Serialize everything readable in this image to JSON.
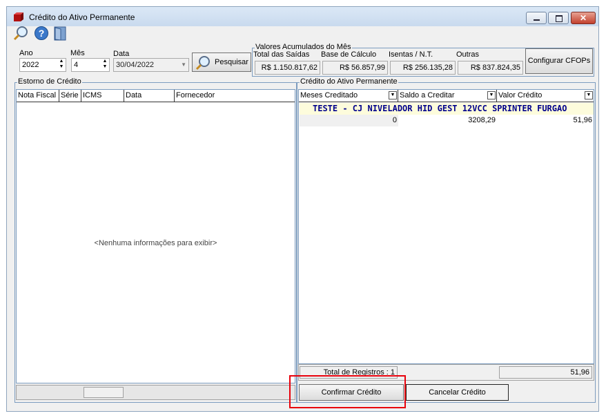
{
  "window": {
    "title": "Crédito do Ativo Permanente"
  },
  "filters": {
    "ano_label": "Ano",
    "ano_value": "2022",
    "mes_label": "Mês",
    "mes_value": "4",
    "data_label": "Data",
    "data_value": "30/04/2022",
    "search_label": "Pesquisar"
  },
  "valores": {
    "group_title": "Valores Acumulados do Mês",
    "total_saidas_label": "Total das Saídas",
    "total_saidas_value": "R$ 1.150.817,62",
    "base_calculo_label": "Base de Cálculo",
    "base_calculo_value": "R$ 56.857,99",
    "isentas_label": "Isentas / N.T.",
    "isentas_value": "R$ 256.135,28",
    "outras_label": "Outras",
    "outras_value": "R$ 837.824,35",
    "configurar_label": "Configurar CFOPs"
  },
  "estorno": {
    "group_title": "Estorno de Crédito",
    "columns": [
      "Nota Fiscal",
      "Série",
      "ICMS",
      "Data",
      "Fornecedor"
    ],
    "empty_text": "<Nenhuma informações para exibir>"
  },
  "credito": {
    "group_title": "Crédito do Ativo Permanente",
    "columns": [
      "Meses Creditado",
      "Saldo a Creditar",
      "Valor Crédito"
    ],
    "group_row": "TESTE - CJ NIVELADOR HID GEST 12VCC SPRINTER FURGAO",
    "rows": [
      {
        "meses": "0",
        "saldo": "3208,29",
        "valor": "51,96"
      }
    ],
    "total_label": "Total de Registros : 1",
    "total_value": "51,96"
  },
  "actions": {
    "confirm_label": "Confirmar Crédito",
    "cancel_label": "Cancelar Crédito"
  },
  "colors": {
    "highlight": "#e8000b",
    "group_row_bg": "#fdfcdc",
    "group_row_text": "#00008b"
  }
}
